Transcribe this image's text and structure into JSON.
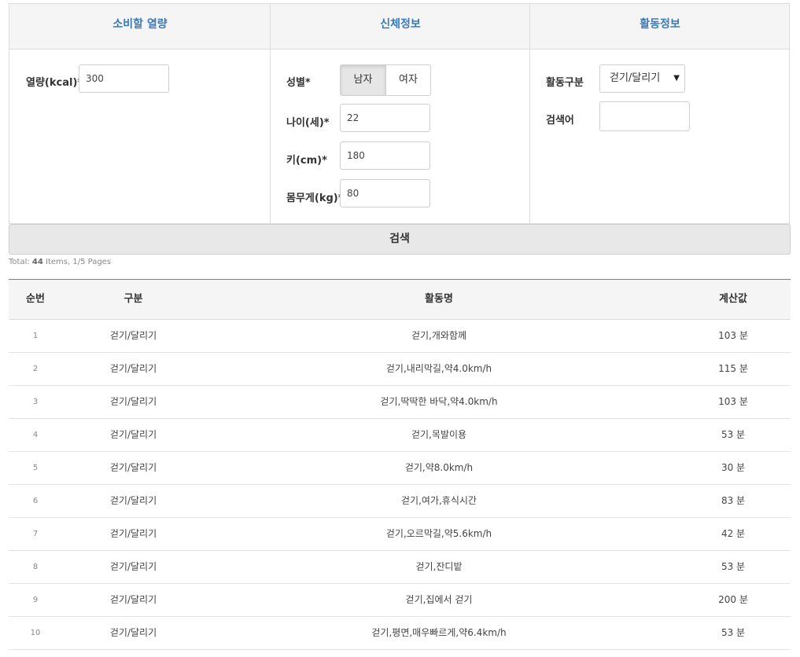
{
  "panel": {
    "col1_title": "소비할 열량",
    "col2_title": "신체정보",
    "col3_title": "활동정보",
    "calorie": {
      "label": "열량(kcal)*",
      "value": "300"
    },
    "gender": {
      "label": "성별*",
      "male": "남자",
      "female": "여자",
      "selected": "male"
    },
    "age": {
      "label": "나이(세)*",
      "value": "22"
    },
    "height": {
      "label": "키(cm)*",
      "value": "180"
    },
    "weight": {
      "label": "몸무게(kg)*",
      "value": "80"
    },
    "activity_type": {
      "label": "활동구분",
      "selected": "걷기/달리기"
    },
    "keyword": {
      "label": "검색어",
      "value": ""
    }
  },
  "search_button": "검색",
  "summary": {
    "prefix": "Total: ",
    "count": "44",
    "rest": " Items, 1/5 Pages"
  },
  "table": {
    "headers": [
      "순번",
      "구분",
      "활동명",
      "계산값"
    ],
    "rows": [
      {
        "no": "1",
        "category": "걷기/달리기",
        "activity": "걷기,개와함께",
        "value": "103 분"
      },
      {
        "no": "2",
        "category": "걷기/달리기",
        "activity": "걷기,내리막길,약4.0km/h",
        "value": "115 분"
      },
      {
        "no": "3",
        "category": "걷기/달리기",
        "activity": "걷기,딱딱한 바닥,약4.0km/h",
        "value": "103 분"
      },
      {
        "no": "4",
        "category": "걷기/달리기",
        "activity": "걷기,목발이용",
        "value": "53 분"
      },
      {
        "no": "5",
        "category": "걷기/달리기",
        "activity": "걷기,약8.0km/h",
        "value": "30 분"
      },
      {
        "no": "6",
        "category": "걷기/달리기",
        "activity": "걷기,여가,휴식시간",
        "value": "83 분"
      },
      {
        "no": "7",
        "category": "걷기/달리기",
        "activity": "걷기,오르막길,약5.6km/h",
        "value": "42 분"
      },
      {
        "no": "8",
        "category": "걷기/달리기",
        "activity": "걷기,잔디밭",
        "value": "53 분"
      },
      {
        "no": "9",
        "category": "걷기/달리기",
        "activity": "걷기,집에서 걷기",
        "value": "200 분"
      },
      {
        "no": "10",
        "category": "걷기/달리기",
        "activity": "걷기,평면,매우빠르게,약6.4km/h",
        "value": "53 분"
      }
    ]
  }
}
